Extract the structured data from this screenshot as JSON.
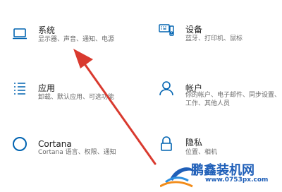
{
  "tiles": {
    "system": {
      "icon": "laptop-icon",
      "title": "系统",
      "desc": "显示器、声音、通知、电源"
    },
    "devices": {
      "icon": "keyboard-devices-icon",
      "title": "设备",
      "desc": "蓝牙、打印机、鼠标"
    },
    "apps": {
      "icon": "apps-list-icon",
      "title": "应用",
      "desc": "卸载、默认应用、可选功能"
    },
    "accounts": {
      "icon": "person-icon",
      "title": "帐户",
      "desc": "你的帐户、电子邮件、同步设置、工作、其他人员"
    },
    "cortana": {
      "icon": "cortana-circle-icon",
      "title": "Cortana",
      "desc": "Cortana 语言、权限、通知"
    },
    "privacy": {
      "icon": "lock-icon",
      "title": "隐私",
      "desc": "位置、相机"
    }
  },
  "annotation": {
    "arrow_color": "#d93a2f"
  },
  "watermark": {
    "text": "鹏鑫装机网",
    "url": "www.0753px.com",
    "color": "#1f5fb8"
  },
  "colors": {
    "accent": "#0063b1",
    "text": "#1a1a1a",
    "desc": "#6b6b6b",
    "background": "#ffffff"
  }
}
